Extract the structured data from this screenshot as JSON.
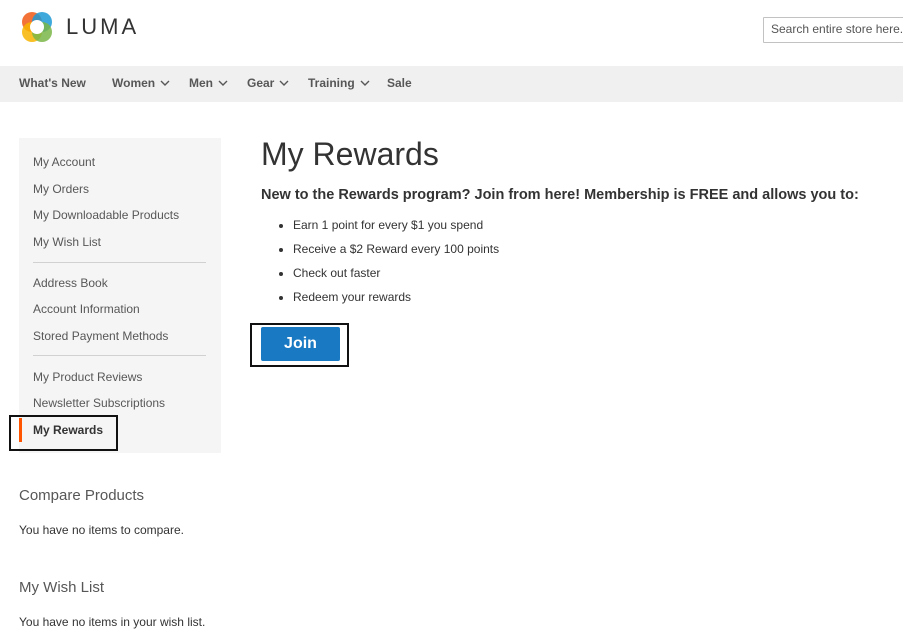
{
  "header": {
    "logo_text": "LUMA",
    "search_placeholder": "Search entire store here..."
  },
  "nav": {
    "items": [
      {
        "label": "What's New",
        "has_dropdown": false
      },
      {
        "label": "Women",
        "has_dropdown": true
      },
      {
        "label": "Men",
        "has_dropdown": true
      },
      {
        "label": "Gear",
        "has_dropdown": true
      },
      {
        "label": "Training",
        "has_dropdown": true
      },
      {
        "label": "Sale",
        "has_dropdown": false
      }
    ]
  },
  "sidebar": {
    "items": [
      {
        "label": "My Account"
      },
      {
        "label": "My Orders"
      },
      {
        "label": "My Downloadable Products"
      },
      {
        "label": "My Wish List"
      },
      {
        "label": "Address Book"
      },
      {
        "label": "Account Information"
      },
      {
        "label": "Stored Payment Methods"
      },
      {
        "label": "My Product Reviews"
      },
      {
        "label": "Newsletter Subscriptions"
      },
      {
        "label": "My Rewards",
        "active": true
      }
    ]
  },
  "main": {
    "title": "My Rewards",
    "intro": "New to the Rewards program? Join from here! Membership is FREE and allows you to:",
    "benefits": [
      "Earn 1 point for every $1 you spend",
      "Receive a $2 Reward every 100 points",
      "Check out faster",
      "Redeem your rewards"
    ],
    "join_label": "Join"
  },
  "compare": {
    "title": "Compare Products",
    "empty_text": "You have no items to compare."
  },
  "wishlist": {
    "title": "My Wish List",
    "empty_text": "You have no items in your wish list."
  },
  "colors": {
    "accent": "#1979c3",
    "active_marker": "#ff5501",
    "nav_bg": "#f0f0f0",
    "sidebar_bg": "#f5f5f5"
  }
}
